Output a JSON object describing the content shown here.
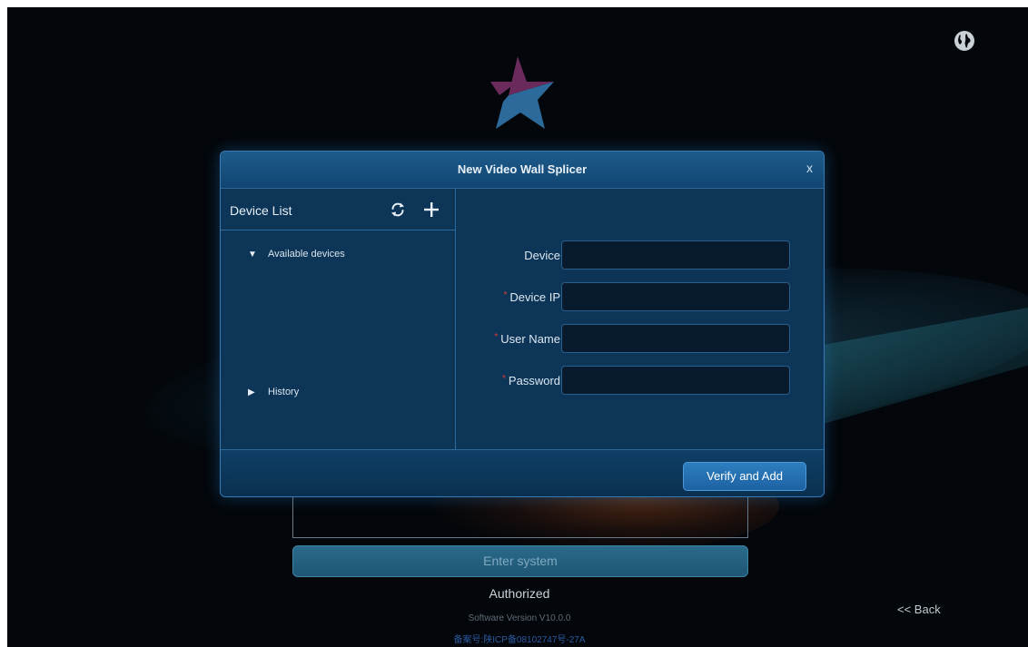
{
  "dialog": {
    "title": "New Video Wall Splicer",
    "close_label": "x",
    "device_list_title": "Device List",
    "tree": {
      "available": "Available devices",
      "history": "History"
    },
    "form": {
      "device_label": "Device",
      "device_ip_label": "Device IP",
      "user_name_label": "User Name",
      "password_label": "Password",
      "required_mark": "*",
      "device_value": "",
      "device_ip_value": "",
      "user_name_value": "",
      "password_value": ""
    },
    "verify_button": "Verify and Add"
  },
  "login": {
    "enter_button": "Enter system",
    "authorized": "Authorized",
    "software_version": "Software Version V10.0.0",
    "icp": "备案号:陕ICP备08102747号-27A",
    "back_link": "<< Back"
  },
  "icons": [
    "globe-icon",
    "star-logo",
    "refresh-icon",
    "plus-icon",
    "triangle-down-icon",
    "triangle-right-icon"
  ],
  "colors": {
    "background": "#03060a",
    "dialog": "#0c3557",
    "accent": "#2d7fc0",
    "required": "#e53935"
  }
}
